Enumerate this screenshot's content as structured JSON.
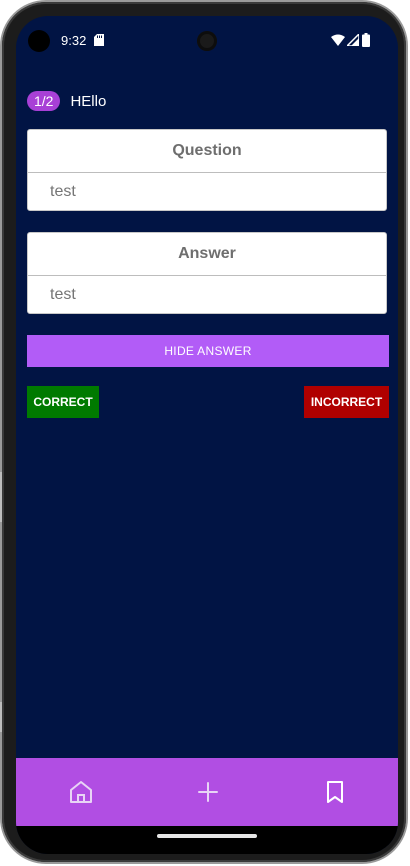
{
  "status_bar": {
    "time": "9:32"
  },
  "header": {
    "counter": "1/2",
    "title": "HEllo"
  },
  "question_card": {
    "label": "Question",
    "value": "test"
  },
  "answer_card": {
    "label": "Answer",
    "value": "test"
  },
  "actions": {
    "hide_answer_label": "HIDE ANSWER",
    "correct_label": "CORRECT",
    "incorrect_label": "INCORRECT"
  },
  "bottom_nav": {
    "items": [
      {
        "icon": "home-icon"
      },
      {
        "icon": "plus-icon"
      },
      {
        "icon": "bookmark-icon"
      }
    ]
  },
  "colors": {
    "background": "#011444",
    "accent": "#b25cf7",
    "nav_background": "#b14ee3",
    "correct": "#007a00",
    "incorrect": "#b00000"
  }
}
